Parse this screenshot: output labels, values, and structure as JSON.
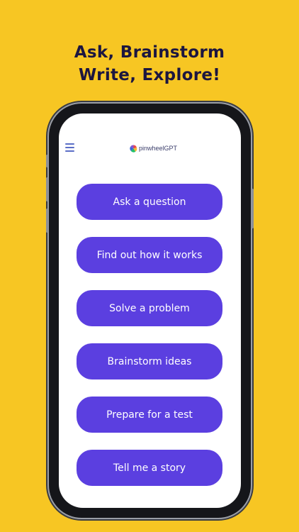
{
  "headline": {
    "line1": "Ask, Brainstorm",
    "line2": "Write, Explore!"
  },
  "app": {
    "logo_text": "pinwheelGPT"
  },
  "actions": [
    {
      "label": "Ask a question"
    },
    {
      "label": "Find out how it works"
    },
    {
      "label": "Solve a problem"
    },
    {
      "label": "Brainstorm ideas"
    },
    {
      "label": "Prepare for a test"
    },
    {
      "label": "Tell me a story"
    }
  ],
  "colors": {
    "background": "#F7C623",
    "headline": "#1c1640",
    "button": "#5b3fe0",
    "menu_icon": "#5b6ec7"
  },
  "icons": {
    "menu": "hamburger-menu-icon",
    "logo": "pinwheel-logo-icon"
  }
}
